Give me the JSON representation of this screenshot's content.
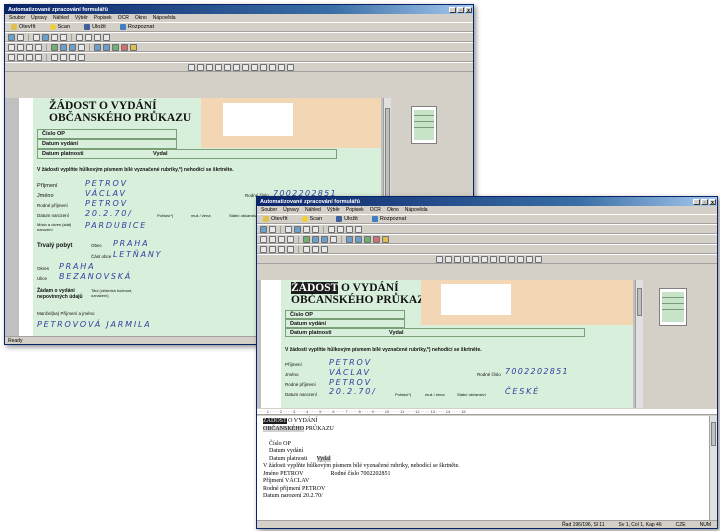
{
  "app": {
    "title": "Automatizované zpracování formulářů",
    "win_controls": [
      "_",
      "▫",
      "x"
    ]
  },
  "menu": [
    "Soubor",
    "Úpravy",
    "Náhled",
    "Výběr",
    "Popisek",
    "OCR",
    "Okno",
    "Nápověda"
  ],
  "toolbar": {
    "open": "Otevřít",
    "scan": "Scan",
    "save": "Uložit",
    "recognize": "Rozpoznat"
  },
  "status": {
    "ready": "Ready",
    "w2_items": [
      "Řad 196/196, Sl 11",
      "Sv 1, Col 1, Kap 46",
      "CZE",
      "NUM"
    ]
  },
  "form": {
    "title_1": "ŽÁDOST",
    "title_1b": "O VYDÁNÍ",
    "title_2": "OBČANSKÉHO PRŮKAZU",
    "cislo_op": "Číslo OP",
    "datum_vydani": "Datum vydání",
    "datum_platnosti": "Datum platnosti",
    "vydal": "Vydal",
    "instruction": "V žádosti vyplňte hůlkovým písmem bílé vyznačené rubriky,*) nehodící se škrtněte.",
    "prijmeni_label": "Příjmení",
    "jmeno_label": "Jméno",
    "rodne_prijmeni_label": "Rodné příjmení",
    "datum_narozeni_label": "Datum narození",
    "pohlavi_label": "Pohlaví*)",
    "pohlavi_value": "muž / žena",
    "statni_obcanstvi_label": "Státní občanství",
    "rodne_cislo_label": "Rodné číslo",
    "misto_label": "Místo a okres (stát) narození",
    "trvaly_pobyt_label": "Trvalý pobyt",
    "obec_label": "Obec",
    "cast_obce_label": "Část obce",
    "okres_label": "Okres",
    "ulice_label": "Ulice",
    "zadam_label": "Žádam o vydání nepovinných údajů",
    "titul_label": "Titul (vědecká hodnost, označení)",
    "manzel_label": "Manžel(ka) Příjmení a jméno",
    "prijmeni": "PETROV",
    "jmeno": "VÁCLAV",
    "rodne_prijmeni": "PETROV",
    "datum_narozeni": "20.2.70/",
    "rodne_cislo": "7002202851",
    "misto": "PARDUBICE",
    "obec": "PRAHA",
    "cast_obce": "LETŇANY",
    "okres": "PRAHA",
    "ulice": "BEZANOVSKÁ",
    "manzel": "PETROVOVÁ JARMILA",
    "obcanstvi": "ČESKÉ"
  },
  "ocr_text": {
    "line1_hl": "ŽÁDOST",
    "line1_rest": " O VYDÁNÍ",
    "line2_hl": "OBČANSKÉHO",
    "line2_rest": " PRŮKAZU",
    "l3": "Číslo OP",
    "l4": "Datum vydání",
    "l5_a": "Datum platnosti",
    "l5_b": "Vydal",
    "l6": "V žádosti vyplňte hůlkovým písmem bílé vyznačené rubriky, nehodící se škrtněte.",
    "l7_a": "Jméno  PETROV",
    "l7_b": "Rodné číslo  7002202851",
    "l8": "Příjmení  VÁCLAV",
    "l9": "Rodné příjmení  PETROV",
    "l10": "Datum narození  20.2.70/"
  },
  "colors": {
    "form_bg": "#d8efdb",
    "title_bar": "#0a246a",
    "stamp": "#f3d6b4",
    "handwriting": "#3040a0"
  }
}
